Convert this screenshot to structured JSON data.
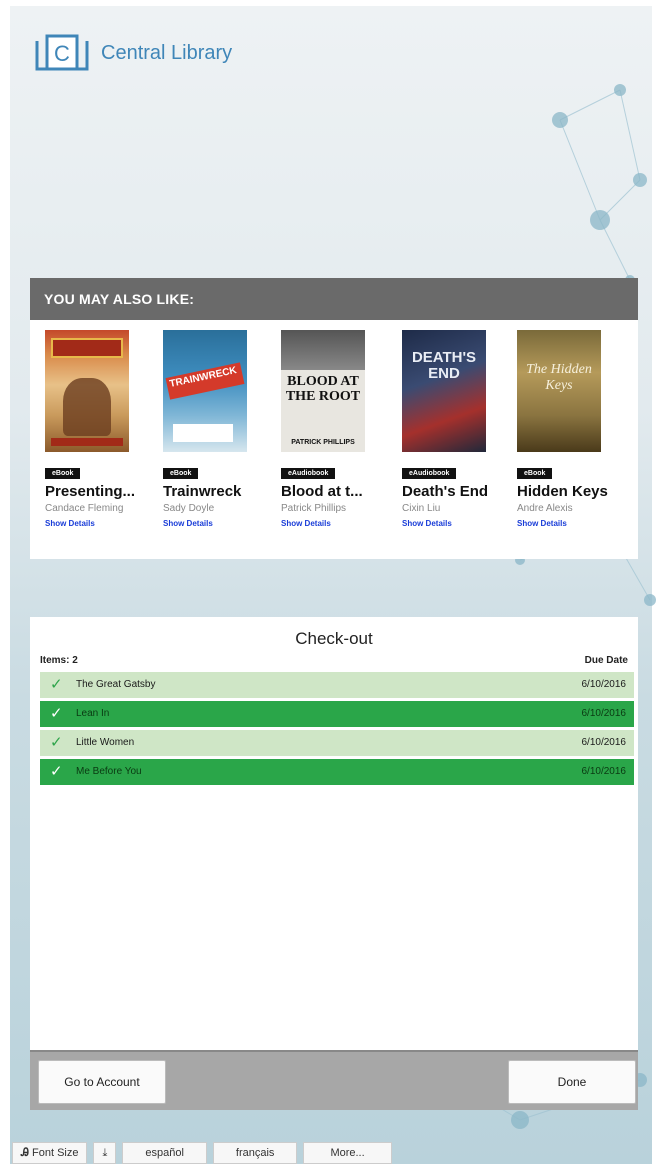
{
  "brand": {
    "name": "Central Library",
    "logo_letter": "C",
    "accent": "#3f86b8"
  },
  "suggestions": {
    "header": "YOU MAY ALSO LIKE:",
    "books": [
      {
        "title": "Presenting...",
        "author": "Candace Fleming",
        "format": "eBook",
        "details": "Show Details",
        "cover_text": ""
      },
      {
        "title": "Trainwreck",
        "author": "Sady Doyle",
        "format": "eBook",
        "details": "Show Details",
        "cover_text": "TRAINWRECK"
      },
      {
        "title": "Blood at t...",
        "author": "Patrick Phillips",
        "format": "eAudiobook",
        "details": "Show Details",
        "cover_text": "BLOOD AT THE ROOT",
        "cover_author": "PATRICK PHILLIPS"
      },
      {
        "title": "Death's End",
        "author": "Cixin Liu",
        "format": "eAudiobook",
        "details": "Show Details",
        "cover_text": "DEATH'S END"
      },
      {
        "title": "Hidden Keys",
        "author": "Andre Alexis",
        "format": "eBook",
        "details": "Show Details",
        "cover_text": "The Hidden Keys"
      }
    ]
  },
  "checkout": {
    "title": "Check-out",
    "items_label": "Items: 2",
    "due_label": "Due Date",
    "items": [
      {
        "title": "The Great Gatsby",
        "due": "6/10/2016"
      },
      {
        "title": "Lean In",
        "due": "6/10/2016"
      },
      {
        "title": "Little Women",
        "due": "6/10/2016"
      },
      {
        "title": "Me Before You",
        "due": "6/10/2016"
      }
    ],
    "buttons": {
      "account": "Go to Account",
      "done": "Done"
    }
  },
  "bottom_bar": {
    "font_size": "Font Size",
    "lang1": "español",
    "lang2": "français",
    "more": "More..."
  }
}
